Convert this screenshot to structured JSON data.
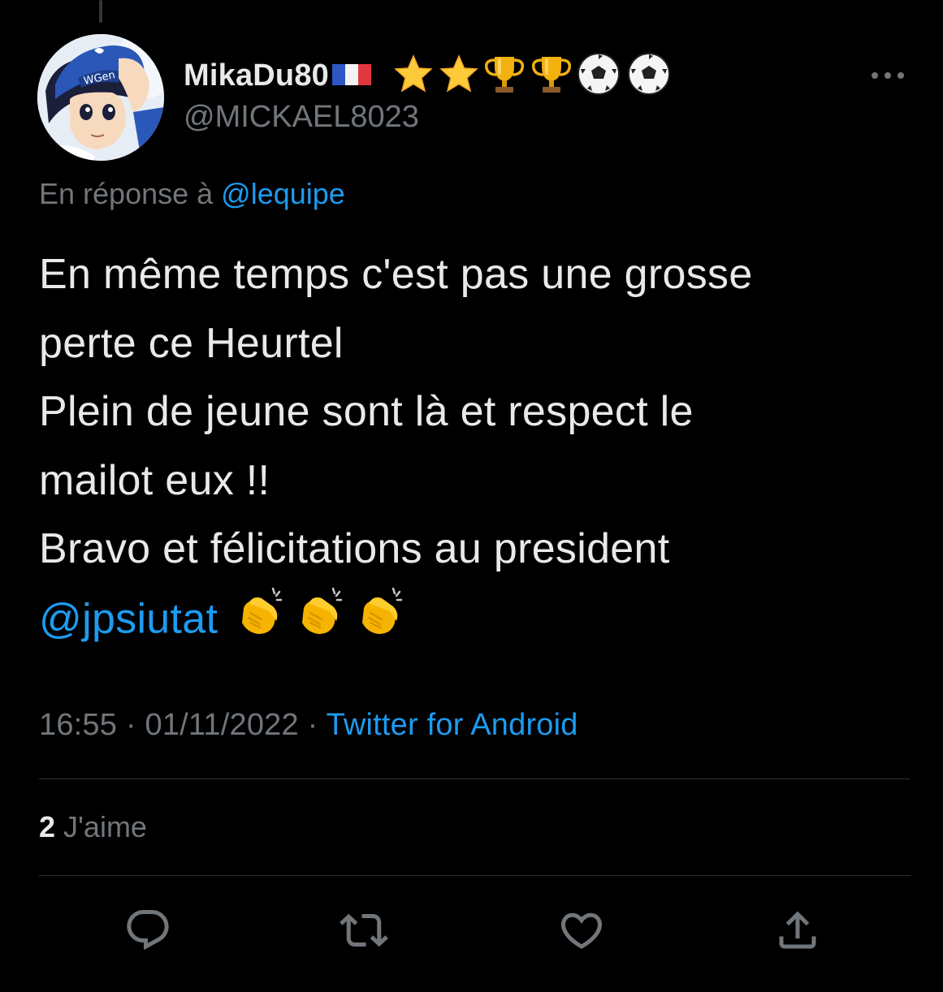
{
  "user": {
    "display_name": "MikaDu80",
    "handle": "@MICKAEL8023",
    "name_emojis": [
      "flag-france",
      "star",
      "star",
      "trophy",
      "trophy",
      "soccer-ball",
      "soccer-ball"
    ],
    "avatar": "captain-tsubasa-cartoon-avatar"
  },
  "reply_to": {
    "prefix": "En réponse à",
    "mention": "@lequipe"
  },
  "tweet": {
    "lines": [
      "En même temps c'est pas une grosse",
      "perte ce Heurtel",
      "Plein de jeune sont là et respect le",
      "mailot eux !!",
      "Bravo et félicitations au president"
    ],
    "mention": "@jpsiutat",
    "trailing_emojis": [
      "clapping-hands",
      "clapping-hands",
      "clapping-hands"
    ]
  },
  "meta": {
    "time": "16:55",
    "separator": "·",
    "date": "01/11/2022",
    "source": "Twitter for Android"
  },
  "stats": {
    "likes_count": "2",
    "likes_label": "J'aime"
  },
  "actions": [
    "reply-icon",
    "retweet-icon",
    "like-icon",
    "share-icon"
  ],
  "colors": {
    "background": "#000000",
    "text": "#e7e9ea",
    "muted": "#71767b",
    "link": "#1d9bf0",
    "divider": "#2f3336"
  }
}
